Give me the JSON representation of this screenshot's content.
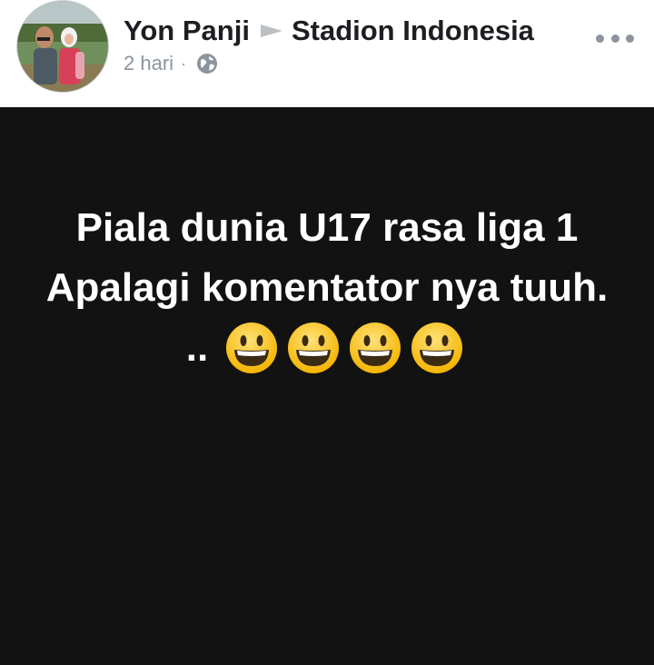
{
  "header": {
    "author": "Yon Panji",
    "group": "Stadion Indonesia",
    "time": "2 hari",
    "separator": "·",
    "privacy_icon": "globe-icon",
    "more_icon": "more-options-icon"
  },
  "post": {
    "line1": "Piala dunia U17 rasa liga 1",
    "line2": "Apalagi komentator nya tuuh.",
    "line3_text": "..",
    "emojis": [
      "grinning-face-emoji",
      "grinning-face-emoji",
      "grinning-face-emoji",
      "grinning-face-emoji"
    ],
    "background_color": "#121212",
    "text_color": "#ffffff"
  }
}
